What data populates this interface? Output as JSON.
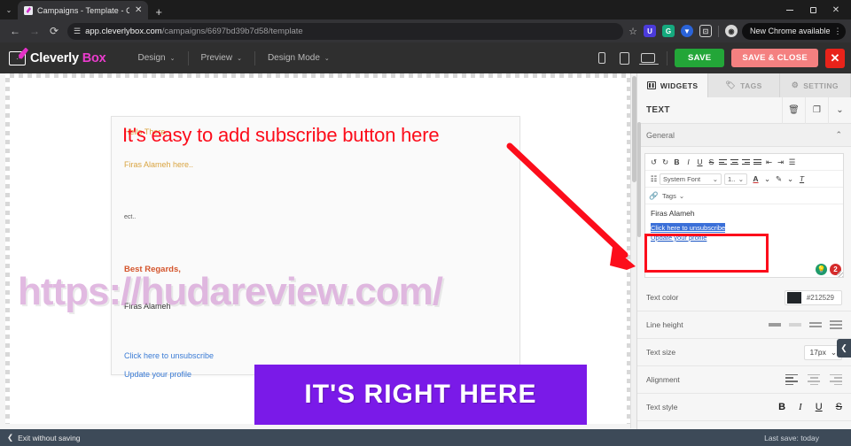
{
  "browser": {
    "tab": {
      "title": "Campaigns - Template - Cleverl",
      "close_icon": "✕",
      "favicon": "cleverlybox-favicon"
    },
    "new_tab_label": "+",
    "tab_list_chevron": "⌄",
    "window_controls": {
      "minimize": "–",
      "maximize": "❐",
      "close": "✕"
    },
    "nav": {
      "back": "←",
      "forward": "→",
      "reload": "⟳",
      "tune_icon": "site-settings-icon"
    },
    "url": {
      "domain": "app.cleverlybox.com",
      "path": "/campaigns/6697bd39b7d58/template"
    },
    "bookmark_icon": "☆",
    "extensions": [
      {
        "name": "extension-u",
        "glyph": "U",
        "color": "#4b3bdb"
      },
      {
        "name": "extension-grammarly",
        "glyph": "G",
        "color": "#15a97e"
      },
      {
        "name": "extension-downloads",
        "glyph": "▼",
        "color": "#2a63d8"
      },
      {
        "name": "extension-split",
        "glyph": "⊡",
        "color": "#3a3a3c"
      }
    ],
    "profile_icon": "profile-avatar",
    "update_pill": {
      "label": "New Chrome available",
      "kebab": "⋮"
    }
  },
  "app_header": {
    "logo": {
      "text_primary": "Cleverly",
      "text_accent": "Box",
      "accent_color": "#ea3ccd"
    },
    "menus": [
      {
        "label": "Design",
        "caret": "⌄"
      },
      {
        "label": "Preview",
        "caret": "⌄"
      },
      {
        "label": "Design Mode",
        "caret": "⌄"
      }
    ],
    "devices": [
      "mobile-view-icon",
      "tablet-view-icon",
      "desktop-view-icon"
    ],
    "save_label": "SAVE",
    "save_close_label": "SAVE & CLOSE",
    "close_label": "✕",
    "colors": {
      "save": "#23a638",
      "save_close": "#f48080",
      "close": "#e8231a"
    }
  },
  "canvas": {
    "email": {
      "greeting": "Hello There,",
      "intro": "Firas Alameh here..",
      "subject_fragment": "ect..",
      "regards": "Best Regards,",
      "signature": "Firas Alameh",
      "unsubscribe": "Click here to unsubscribe",
      "update_profile": "Update your profile"
    },
    "watermark": "https://hudareview.com/"
  },
  "panel": {
    "tabs": [
      {
        "label": "WIDGETS",
        "icon": "widgets-icon",
        "active": true
      },
      {
        "label": "TAGS",
        "icon": "tag-icon",
        "active": false
      },
      {
        "label": "SETTING",
        "icon": "gear-icon",
        "active": false
      }
    ],
    "widget": {
      "title": "TEXT",
      "delete_icon": "🗑",
      "duplicate_icon": "❐",
      "collapse_icon": "⌄"
    },
    "section": {
      "title": "General",
      "chevron": "⌃"
    },
    "editor": {
      "toolbar_row1": [
        {
          "name": "undo-icon",
          "glyph": "↺"
        },
        {
          "name": "redo-icon",
          "glyph": "↻"
        },
        {
          "name": "bold-icon",
          "glyph": "B"
        },
        {
          "name": "italic-icon",
          "glyph": "I"
        },
        {
          "name": "underline-icon",
          "glyph": "U"
        },
        {
          "name": "strikethrough-icon",
          "glyph": "S"
        },
        {
          "name": "align-left-icon",
          "glyph": "≡"
        },
        {
          "name": "align-center-icon",
          "glyph": "≡"
        },
        {
          "name": "align-right-icon",
          "glyph": "≡"
        },
        {
          "name": "align-justify-icon",
          "glyph": "≡"
        },
        {
          "name": "outdent-icon",
          "glyph": "⇤"
        },
        {
          "name": "indent-icon",
          "glyph": "⇥"
        },
        {
          "name": "ordered-list-icon",
          "glyph": "☰"
        }
      ],
      "font_name": "System Font",
      "font_size": "1..",
      "text_color_icon": "A",
      "highlight_icon": "highlighter-icon",
      "clear_format_icon": "clear-formatting-icon",
      "link_icon": "link-icon",
      "tags_label": "Tags",
      "content_name": "Firas Alameh",
      "content_link_1": "Click here to unsubscribe",
      "content_link_2": "Update your profile",
      "badge_hint": "💡",
      "badge_count": "2"
    },
    "properties": [
      {
        "label": "Text color",
        "value": "#212529",
        "swatch": "#212529"
      },
      {
        "label": "Line height",
        "value": ""
      },
      {
        "label": "Text size",
        "value": "17px"
      },
      {
        "label": "Alignment",
        "value": ""
      },
      {
        "label": "Text style",
        "value": ""
      }
    ],
    "text_style_glyphs": [
      "B",
      "I",
      "U",
      "S"
    ],
    "collapse_arrow": "❮"
  },
  "annotations": {
    "headline": "It's easy to add subscribe button here",
    "banner": "IT'S RIGHT HERE",
    "arrow_color": "#fc0d1b",
    "banner_color": "#7a1ae8"
  },
  "status_bar": {
    "exit_label": "Exit without saving",
    "exit_caret": "❮",
    "last_save": "Last save: today"
  }
}
